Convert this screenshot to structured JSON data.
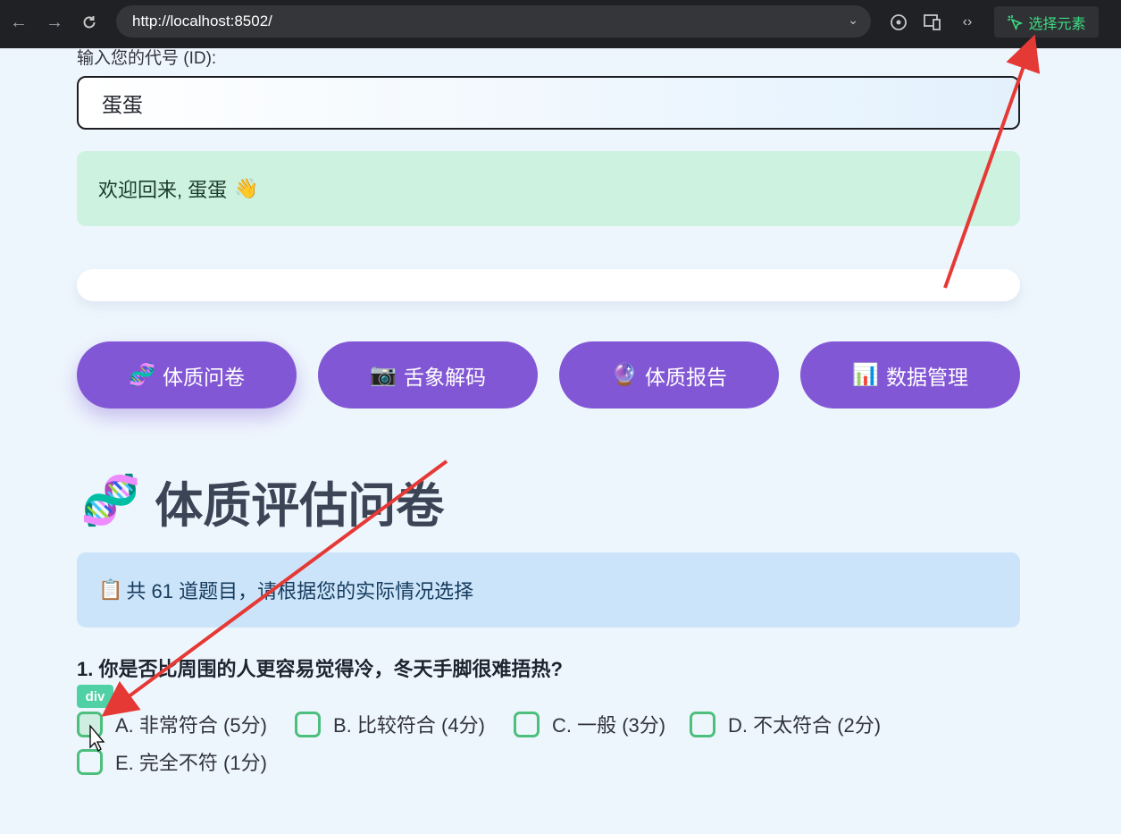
{
  "browser": {
    "url": "http://localhost:8502/",
    "select_element_label": "选择元素"
  },
  "form": {
    "id_label": "输入您的代号 (ID):",
    "id_value": "蛋蛋"
  },
  "welcome": {
    "text": "欢迎回来, 蛋蛋",
    "emoji": "👋"
  },
  "tabs": [
    {
      "icon": "🧬",
      "label": "体质问卷"
    },
    {
      "icon": "📷",
      "label": "舌象解码"
    },
    {
      "icon": "🔮",
      "label": "体质报告"
    },
    {
      "icon": "📊",
      "label": "数据管理"
    }
  ],
  "page": {
    "title_icon": "🧬",
    "title": "体质评估问卷",
    "info_icon": "📋",
    "info_text": "共 61 道题目，请根据您的实际情况选择"
  },
  "question": {
    "text": "1. 你是否比周围的人更容易觉得冷，冬天手脚很难捂热?",
    "options": [
      "A. 非常符合 (5分)",
      "B. 比较符合 (4分)",
      "C. 一般 (3分)",
      "D. 不太符合 (2分)",
      "E. 完全不符 (1分)"
    ]
  },
  "devtools_badge": "div",
  "colors": {
    "accent": "#8257d5",
    "checkbox": "#4cbf7d",
    "annotation_arrow": "#e53935"
  }
}
